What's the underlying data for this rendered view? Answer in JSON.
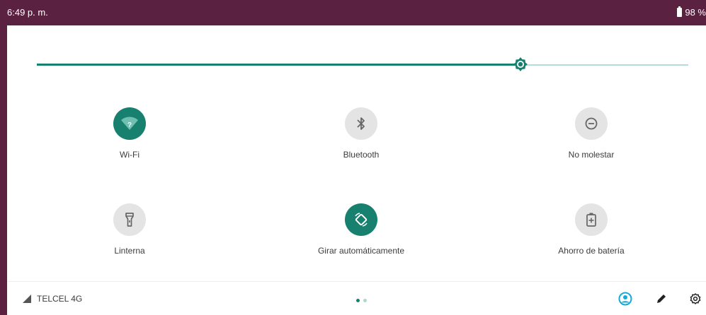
{
  "status_bar": {
    "time": "6:49 p. m.",
    "battery_level": "98 %",
    "battery_icon": "battery-icon"
  },
  "brightness": {
    "level_fraction": 0.742,
    "thumb_icon": "brightness-icon"
  },
  "tiles": [
    {
      "label": "Wi-Fi",
      "icon": "wifi-unknown-icon",
      "state": "on"
    },
    {
      "label": "Bluetooth",
      "icon": "bluetooth-icon",
      "state": "off"
    },
    {
      "label": "No molestar",
      "icon": "do-not-disturb-icon",
      "state": "off"
    },
    {
      "label": "Linterna",
      "icon": "flashlight-icon",
      "state": "off"
    },
    {
      "label": "Girar automáticamente",
      "icon": "auto-rotate-icon",
      "state": "on"
    },
    {
      "label": "Ahorro de batería",
      "icon": "battery-saver-icon",
      "state": "off"
    }
  ],
  "footer": {
    "carrier": "TELCEL 4G",
    "signal_icon": "signal-icon",
    "page_count": 2,
    "active_page": 1,
    "user_icon": "user-icon",
    "edit_icon": "edit-icon",
    "settings_icon": "settings-icon"
  },
  "colors": {
    "accent": "#17806f",
    "status_bar": "#5a2141",
    "tile_off": "#e4e4e4",
    "user_icon": "#1aa8d6"
  }
}
